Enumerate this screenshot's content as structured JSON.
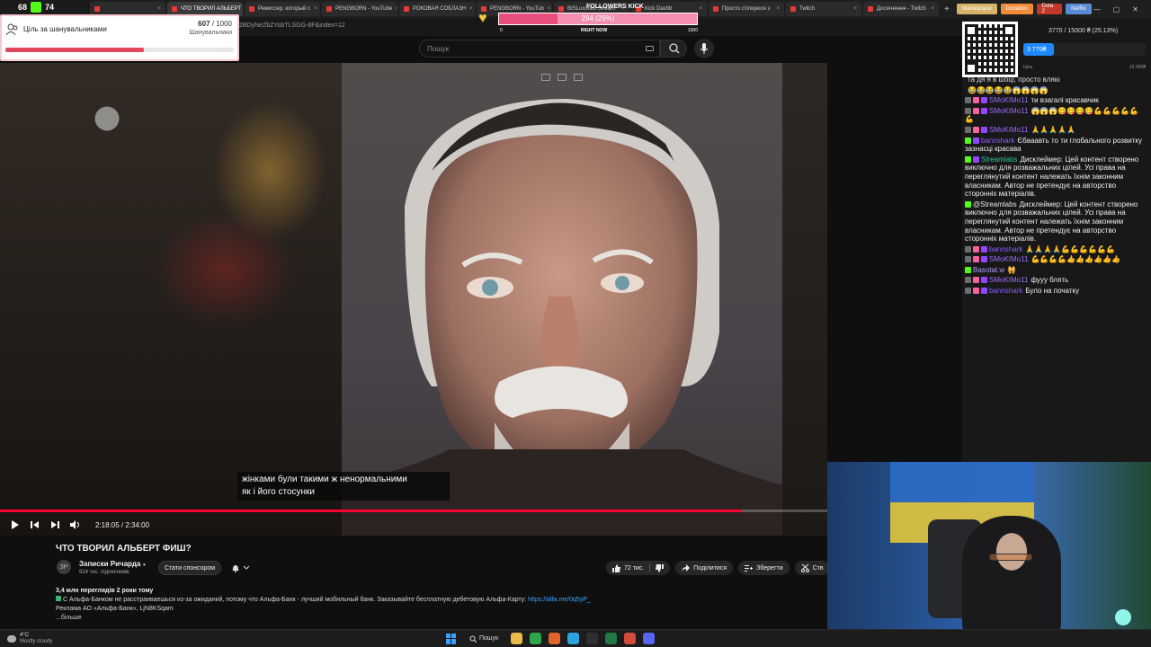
{
  "browser": {
    "tabs": [
      {
        "label": "",
        "active": false
      },
      {
        "label": "ЧТО ТВОРИЛ АЛЬБЕРТ",
        "active": true
      },
      {
        "label": "Режиссер, который с",
        "active": false
      },
      {
        "label": "PENGBORN - YouTube",
        "active": false
      },
      {
        "label": "РОКОВАЯ СОБЛАЗН",
        "active": false
      },
      {
        "label": "PENGBORN - YouTub",
        "active": false
      },
      {
        "label": "BISLuxoriks Stream",
        "active": false
      },
      {
        "label": "Kick Dashb",
        "active": false
      },
      {
        "label": "Просто стілкуюся з",
        "active": false
      },
      {
        "label": "Twitch",
        "active": false
      },
      {
        "label": "Досягнення - Twitch",
        "active": false
      }
    ],
    "bookmarks": [
      {
        "label": "Marketplace",
        "color": "#d7b36a"
      },
      {
        "label": "Donation",
        "color": "#f08c3a"
      },
      {
        "label": "Dota 2",
        "color": "#c0392b"
      },
      {
        "label": "Netflix",
        "color": "#5a8bd6"
      }
    ],
    "url": "2BDyNeZbZYobTLSGG-8F&index=12",
    "add_tab": "+",
    "window_controls": [
      "—",
      "▢",
      "✕"
    ]
  },
  "youtube": {
    "search_placeholder": "Пошук",
    "video": {
      "subtitle_lines": [
        "жінками були такими ж ненормальними",
        "як і його стосунки"
      ],
      "current_time": "2:18:05",
      "duration": "2:34:00",
      "progress_fraction": 0.8965
    },
    "title": "ЧТО ТВОРИЛ АЛЬБЕРТ ФИШ?",
    "channel": {
      "avatar_text": "ЗР",
      "name": "Записки Ричарда",
      "subscribers": "914 тис. підписників",
      "sponsor_label": "Стати спонсором"
    },
    "actions": {
      "likes": "72 тис.",
      "share": "Поділитися",
      "save": "Зберегти",
      "clip": "Ств"
    },
    "description": {
      "meta": "3,4 млн переглядів  2 роки тому",
      "line1": "С Альфа-Банком не расстраиваешься из-за ожиданий, потому что Альфа-Банк - лучший мобильный банк. Заказывайте бесплатную дебетовую Альфа-Карту: ",
      "link": "https://alfa.me/0q5yP_",
      "line2": "Реклама АО «Альфа-Банк», LjN8KSqam",
      "more": "...більше"
    }
  },
  "overlays": {
    "top_counter": {
      "left": "68",
      "right": "74"
    },
    "follower_goal": {
      "title": "Ціль за шанувальниками",
      "current": "607",
      "target": "1000",
      "label": "Шанувальники",
      "fraction": 0.607
    },
    "kick_followers": {
      "title": "FOLLOWERS KICK",
      "value": "294 (29%)",
      "low": "0",
      "mid": "RIGHT NOW",
      "high": "1000",
      "fraction": 0.294
    },
    "donation_goal": {
      "text": "3770 / 15000 ₴ (25.13%)",
      "amount": "3 770₴",
      "start_label": "Ціль",
      "end_label": "15 000₴",
      "fraction": 0.2513
    }
  },
  "chat": [
    {
      "badges": [],
      "user": "",
      "user_color": "#bfbfbf",
      "text": "та дя я в шоці, просто вляю",
      "text_color": "#dcdcdc"
    },
    {
      "badges": [],
      "user": "",
      "user_color": "#bfbfbf",
      "text": "😂😂😂😂😂😱😱😱😱",
      "text_color": "#ffb300"
    },
    {
      "badges": [
        "gray",
        "pink",
        "purple"
      ],
      "user": "SMoKIMo11",
      "user_color": "#9b6bff",
      "text": "ти взагалі красавчик",
      "text_color": "#f0f0f0"
    },
    {
      "badges": [
        "gray",
        "pink",
        "purple"
      ],
      "user": "SMoKIMo11",
      "user_color": "#9b6bff",
      "text": "😱😱😱😋😋😋😋💪💪💪💪💪💪",
      "text_color": "#ffb300"
    },
    {
      "badges": [
        "gray",
        "pink",
        "purple"
      ],
      "user": "SMoKIMo11",
      "user_color": "#9b6bff",
      "text": "🙏🙏🙏🙏🙏",
      "text_color": "#ffb300"
    },
    {
      "badges": [
        "green",
        "purple"
      ],
      "user": "bannshark",
      "user_color": "#8a5cff",
      "text": "Єбааавть то ти глобального розвитку зазнасці красава",
      "text_color": "#f0f0f0"
    },
    {
      "badges": [
        "green",
        "purple"
      ],
      "user": "Streamlabs",
      "user_color": "#31c3a2",
      "text": "Дисклеймер: Цей контент створено виключно для розважальних цілей. Усі права на переглянутий контент належать їхнім законним власникам. Автор не претендує на авторство сторонніх матеріалів.",
      "text_color": "#f0f0f0"
    },
    {
      "badges": [
        "green"
      ],
      "user": "@Streamlabs",
      "user_color": "#e6e6e6",
      "text": "Дисклеймер: Цей контент створено виключно для розважальних цілей. Усі права на переглянутий контент належать їхнім законним власникам. Автор не претендує на авторство сторонніх матеріалів.",
      "text_color": "#f0f0f0"
    },
    {
      "badges": [
        "gray",
        "pink",
        "purple"
      ],
      "user": "bannshark",
      "user_color": "#8a5cff",
      "text": "🙏🙏🙏🙏💪💪💪💪💪💪",
      "text_color": "#ffb300"
    },
    {
      "badges": [
        "gray",
        "pink",
        "purple"
      ],
      "user": "SMoKIMo11",
      "user_color": "#9b6bff",
      "text": "💪💪💪💪👍👍👍👍👍👍",
      "text_color": "#ffb300"
    },
    {
      "badges": [
        "green"
      ],
      "user": "Basotat.w",
      "user_color": "#b49aff",
      "text": "🙀",
      "text_color": "#53fc18"
    },
    {
      "badges": [
        "gray",
        "pink",
        "purple"
      ],
      "user": "SMoKIMo11",
      "user_color": "#9b6bff",
      "text": "фууу блять",
      "text_color": "#f0f0f0"
    },
    {
      "badges": [
        "gray",
        "pink",
        "purple"
      ],
      "user": "bannshark",
      "user_color": "#8a5cff",
      "text": "Було на початку",
      "text_color": "#f0f0f0"
    }
  ],
  "taskbar": {
    "temperature": "4°C",
    "condition": "Mostly cloudy",
    "search_label": "Пошук",
    "app_icons": [
      {
        "name": "file-explorer-icon",
        "color": "#e9b949"
      },
      {
        "name": "chrome-icon",
        "color": "#2ea64b"
      },
      {
        "name": "firefox-icon",
        "color": "#e2632c"
      },
      {
        "name": "telegram-icon",
        "color": "#2aa3df"
      },
      {
        "name": "obs-icon",
        "color": "#2f2f2f"
      },
      {
        "name": "excel-icon",
        "color": "#1f7a45"
      },
      {
        "name": "chrome-alt-icon",
        "color": "#d54a3a"
      },
      {
        "name": "discord-icon",
        "color": "#5865f2"
      }
    ]
  }
}
